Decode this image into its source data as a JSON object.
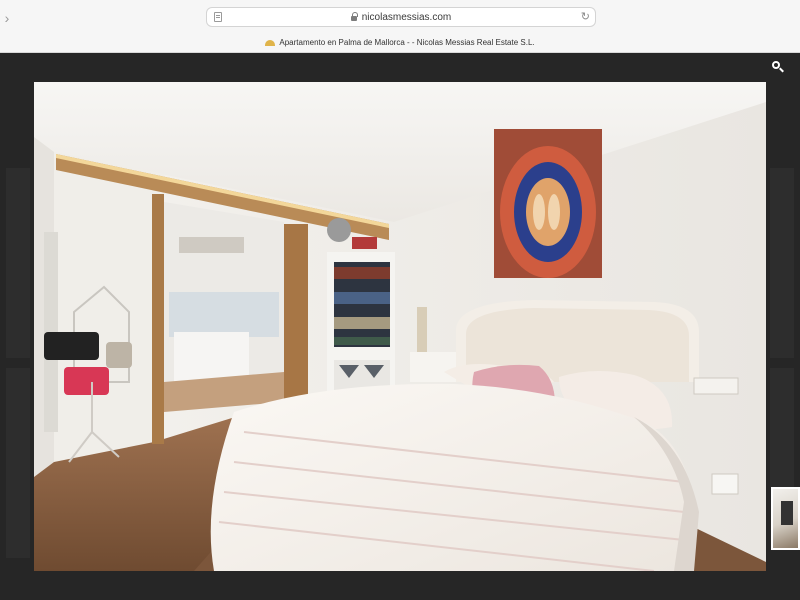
{
  "browser": {
    "url": "nicolasmessias.com",
    "tab_title": "Apartamento en Palma de Mallorca - - Nicolas Messias Real Estate S.L.",
    "back_icon": "chevron-left-icon",
    "reload_icon": "reload-icon"
  },
  "site": {
    "search_icon": "search-icon"
  },
  "lightbox": {
    "photo_subject": "bedroom with double bed and open sliding door",
    "thumbnail_icon": "image-thumbnail"
  }
}
